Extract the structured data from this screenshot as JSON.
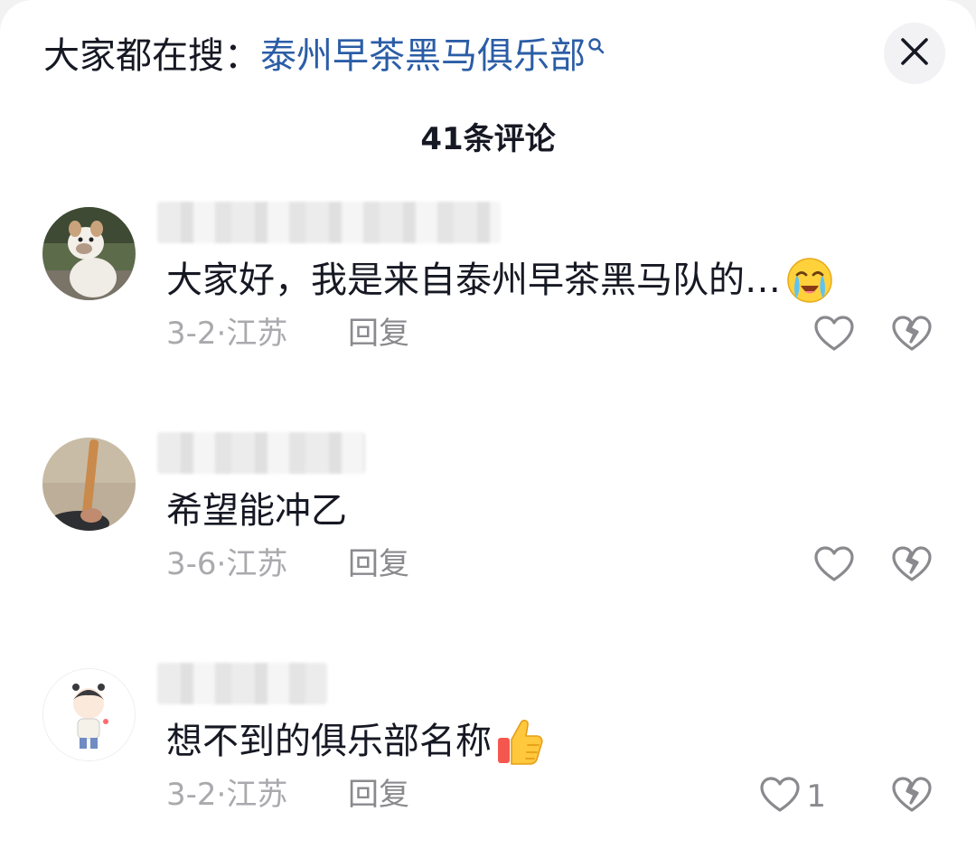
{
  "header": {
    "hot_search_prefix": "大家都在搜：",
    "hot_search_keyword": "泰州早茶黑马俱乐部",
    "close_icon": "close-icon"
  },
  "comment_count_label": "41条评论",
  "comments": [
    {
      "text": "大家好，我是来自泰州早茶黑马队的…",
      "emoji": "crying-face-emoji",
      "date_location": "3-2·江苏",
      "reply_label": "回复",
      "like_count": ""
    },
    {
      "text": "希望能冲乙",
      "date_location": "3-6·江苏",
      "reply_label": "回复",
      "like_count": ""
    },
    {
      "text": "想不到的俱乐部名称",
      "emoji": "thumbs-up-emoji",
      "date_location": "3-2·江苏",
      "reply_label": "回复",
      "like_count": "1"
    }
  ],
  "colors": {
    "keyword": "#2b5da6",
    "text_primary": "#161823",
    "text_secondary": "#aaaaae"
  }
}
